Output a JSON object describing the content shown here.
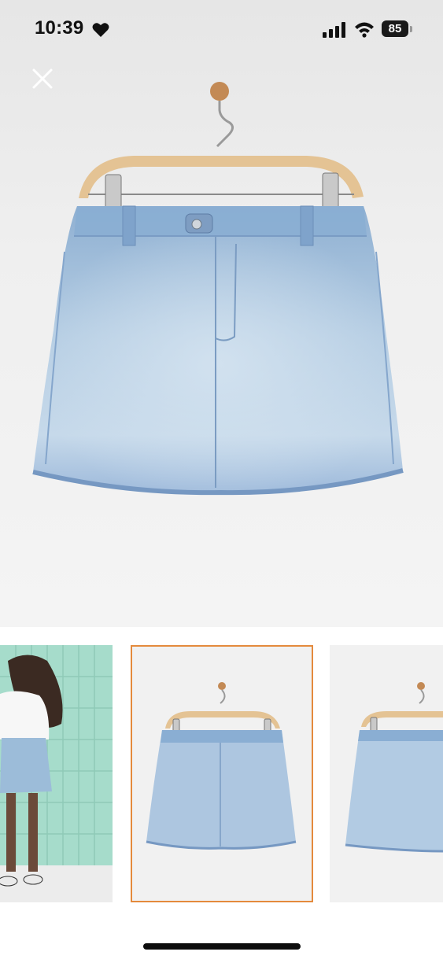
{
  "status_bar": {
    "time": "10:39",
    "battery_level": "85",
    "icons": [
      "heart-icon",
      "signal-icon",
      "wifi-icon",
      "battery-icon"
    ]
  },
  "viewer": {
    "close_icon": "close-icon",
    "selected_index": 1,
    "thumbnails": [
      {
        "name": "model-back-view"
      },
      {
        "name": "skirt-on-hanger-front"
      },
      {
        "name": "skirt-on-hanger-back"
      }
    ]
  },
  "colors": {
    "selected_border": "#e48a3c",
    "denim": "#a9c3dc",
    "hanger_wood": "#e3c08f",
    "tile_wall": "#a6dccb"
  }
}
